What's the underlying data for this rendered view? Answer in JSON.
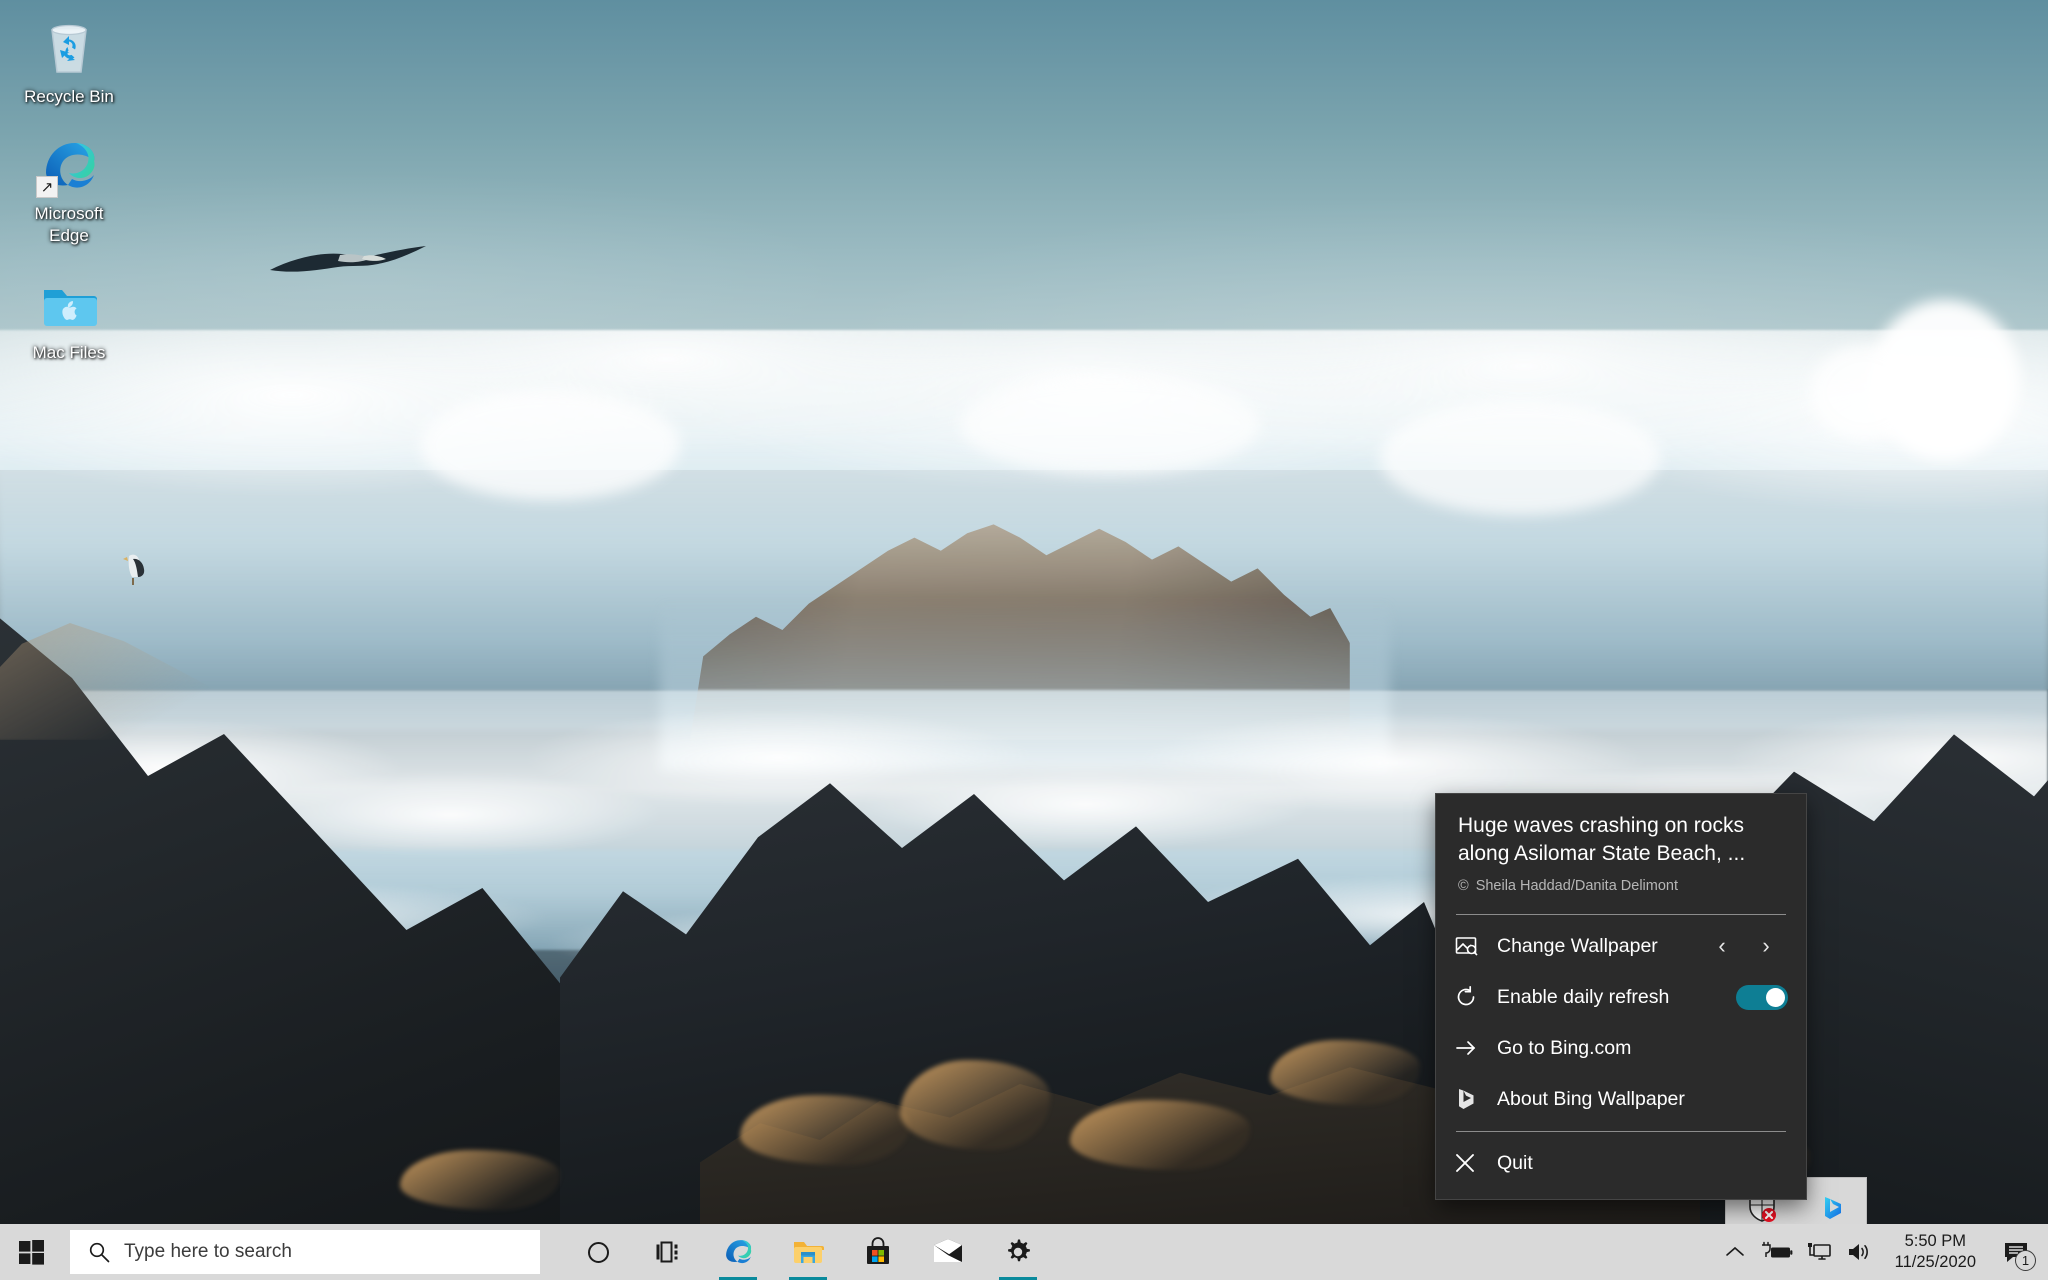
{
  "desktop": {
    "icons": [
      {
        "name": "recycle-bin",
        "label": "Recycle Bin",
        "icon": "recycle-bin-icon",
        "shortcut": false
      },
      {
        "name": "microsoft-edge",
        "label": "Microsoft Edge",
        "icon": "edge-icon",
        "shortcut": true
      },
      {
        "name": "mac-files",
        "label": "Mac Files",
        "icon": "folder-apple-icon",
        "shortcut": false
      }
    ],
    "wallpaper": {
      "description": "Huge waves crashing on rocks along Asilomar State Beach, Pacific Grove, California",
      "sky_color": "#7ba4ae",
      "surf_color": "#eef6f9",
      "rock_color": "#1e2327",
      "highlight_color": "#e2ac68"
    }
  },
  "bing_menu": {
    "title": "Huge waves crashing on rocks along Asilomar State Beach, ...",
    "copyright_symbol": "©",
    "credit": "Sheila Haddad/Danita Delimont",
    "accent_color": "#0e7e94",
    "background_color": "#2b2b2b",
    "items": [
      {
        "key": "change-wallpaper",
        "label": "Change Wallpaper",
        "icon": "image-search-icon",
        "prev_label": "‹",
        "next_label": "›"
      },
      {
        "key": "enable-daily-refresh",
        "label": "Enable daily refresh",
        "icon": "refresh-icon",
        "toggle_on": true
      },
      {
        "key": "go-to-bing",
        "label": "Go to Bing.com",
        "icon": "arrow-right-icon"
      },
      {
        "key": "about-bing-wallpaper",
        "label": "About Bing Wallpaper",
        "icon": "bing-logo-icon"
      },
      {
        "key": "quit",
        "label": "Quit",
        "icon": "close-x-icon"
      }
    ]
  },
  "tray_flyout": {
    "icons": [
      {
        "name": "security-shield-warning-icon",
        "label": "Windows Security"
      },
      {
        "name": "bing-wallpaper-tray-icon",
        "label": "Bing Wallpaper"
      }
    ]
  },
  "taskbar": {
    "start_label": "Start",
    "search": {
      "placeholder": "Type here to search",
      "value": "",
      "icon": "search-icon"
    },
    "buttons": [
      {
        "key": "cortana",
        "name": "cortana-button",
        "label": "Cortana",
        "active": false
      },
      {
        "key": "task-view",
        "name": "task-view-button",
        "label": "Task View",
        "active": false
      }
    ],
    "apps": [
      {
        "key": "edge",
        "name": "taskbar-microsoft-edge",
        "label": "Microsoft Edge",
        "active": true
      },
      {
        "key": "explorer",
        "name": "taskbar-file-explorer",
        "label": "File Explorer",
        "active": true
      },
      {
        "key": "store",
        "name": "taskbar-microsoft-store",
        "label": "Microsoft Store",
        "active": false
      },
      {
        "key": "mail",
        "name": "taskbar-mail",
        "label": "Mail",
        "active": false
      },
      {
        "key": "settings",
        "name": "taskbar-settings",
        "label": "Settings",
        "active": true
      }
    ],
    "tray": [
      {
        "key": "overflow",
        "name": "show-hidden-icons-button",
        "label": "Show hidden icons",
        "icon": "chevron-up-icon"
      },
      {
        "key": "battery",
        "name": "battery-icon",
        "label": "Battery charging",
        "icon": "battery-plug-icon"
      },
      {
        "key": "network",
        "name": "network-icon",
        "label": "Network",
        "icon": "monitor-network-icon"
      },
      {
        "key": "volume",
        "name": "volume-icon",
        "label": "Speakers",
        "icon": "speaker-icon"
      }
    ],
    "clock": {
      "time": "5:50 PM",
      "date": "11/25/2020"
    },
    "notifications": {
      "count": "1",
      "icon": "action-center-icon"
    }
  }
}
